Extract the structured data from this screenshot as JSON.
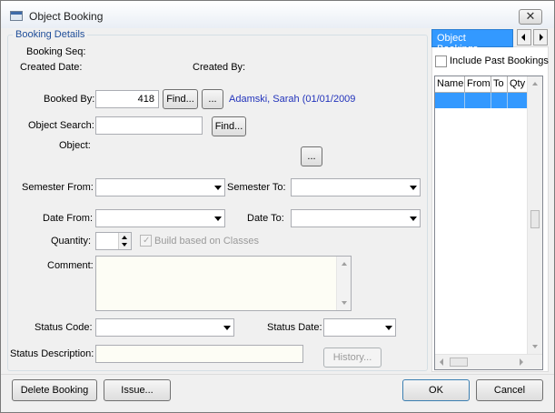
{
  "window": {
    "title": "Object Booking"
  },
  "booking_details": {
    "group_title": "Booking Details",
    "booking_seq_label": "Booking Seq:",
    "created_date_label": "Created Date:",
    "created_by_label": "Created By:",
    "booked_by_label": "Booked By:",
    "booked_by_value": "418",
    "find_label": "Find...",
    "ellipsis_label": "...",
    "booked_by_name": "Adamski, Sarah (01/01/2009",
    "object_search_label": "Object Search:",
    "object_search_value": "",
    "object_label": "Object:",
    "semester_from_label": "Semester From:",
    "semester_to_label": "Semester To:",
    "date_from_label": "Date From:",
    "date_to_label": "Date To:",
    "quantity_label": "Quantity:",
    "build_based_label": "Build based on Classes",
    "comment_label": "Comment:",
    "status_code_label": "Status Code:",
    "status_date_label": "Status Date:",
    "status_description_label": "Status Description:",
    "history_label": "History..."
  },
  "side_panel": {
    "tab_label": "Object Bookings",
    "include_past_label": "Include Past Bookings",
    "columns": [
      "Name",
      "From",
      "To",
      "Qty"
    ]
  },
  "footer": {
    "delete_label": "Delete Booking",
    "issue_label": "Issue...",
    "ok_label": "OK",
    "cancel_label": "Cancel"
  }
}
